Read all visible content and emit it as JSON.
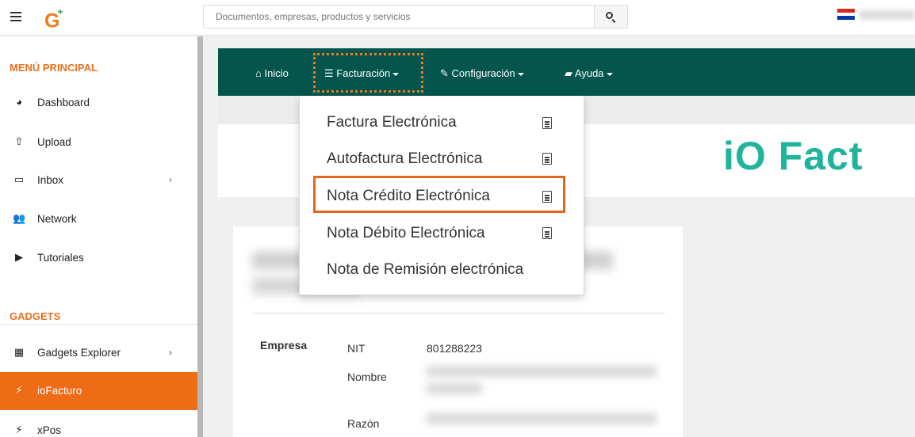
{
  "header": {
    "logo_text": "G",
    "logo_mark": "+",
    "search": {
      "placeholder": "Documentos, empresas, productos y servicios",
      "icon": "search-icon"
    },
    "flag_colors": [
      "#d52b1e",
      "#ffffff",
      "#0038a8"
    ]
  },
  "sidebar": {
    "main_title": "MENÚ PRINCIPAL",
    "main_items": [
      {
        "label": "Dashboard",
        "icon": "dashboard-icon",
        "glyph": "◕"
      },
      {
        "label": "Upload",
        "icon": "upload-icon",
        "glyph": "⇧"
      },
      {
        "label": "Inbox",
        "icon": "inbox-icon",
        "glyph": "▭",
        "chevron": "›"
      },
      {
        "label": "Network",
        "icon": "network-icon",
        "glyph": "👥"
      },
      {
        "label": "Tutoriales",
        "icon": "video-icon",
        "glyph": "▶"
      }
    ],
    "gadgets_title": "GADGETS",
    "gadget_items": [
      {
        "label": "Gadgets Explorer",
        "icon": "grid-icon",
        "glyph": "▦",
        "chevron": "›"
      },
      {
        "label": "ioFacturo",
        "icon": "plug-icon",
        "glyph": "⚡",
        "active": true
      },
      {
        "label": "xPos",
        "icon": "plug-icon",
        "glyph": "⚡"
      }
    ],
    "accent_color": "#ef6c17"
  },
  "navbar": {
    "inicio": "Inicio",
    "facturacion": "Facturación",
    "configuracion": "Configuración",
    "ayuda": "Ayuda",
    "color": "#03554d"
  },
  "dropdown": {
    "items": [
      "Factura Electrónica",
      "Autofactura Electrónica",
      "Nota Crédito Electrónica",
      "Nota Débito Electrónica",
      "Nota de Remisión electrónica"
    ],
    "highlighted": "Nota Crédito Electrónica"
  },
  "banner": {
    "brand": "iO Fact"
  },
  "card": {
    "section_label": "Empresa",
    "nit_label": "NIT",
    "nit_value": "801288223",
    "nombre_label": "Nombre",
    "razon_label": "Razón"
  }
}
